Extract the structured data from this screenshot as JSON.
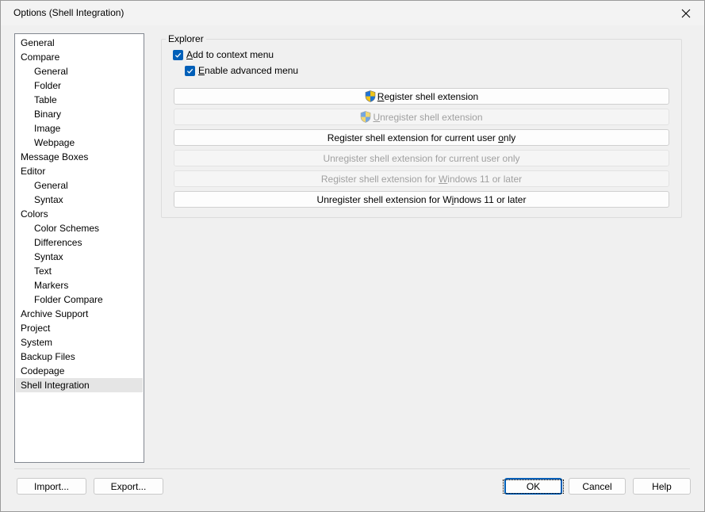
{
  "window": {
    "title": "Options (Shell Integration)"
  },
  "tree": {
    "items": [
      {
        "label": "General",
        "level": 0
      },
      {
        "label": "Compare",
        "level": 0
      },
      {
        "label": "General",
        "level": 1
      },
      {
        "label": "Folder",
        "level": 1
      },
      {
        "label": "Table",
        "level": 1
      },
      {
        "label": "Binary",
        "level": 1
      },
      {
        "label": "Image",
        "level": 1
      },
      {
        "label": "Webpage",
        "level": 1
      },
      {
        "label": "Message Boxes",
        "level": 0
      },
      {
        "label": "Editor",
        "level": 0
      },
      {
        "label": "General",
        "level": 1
      },
      {
        "label": "Syntax",
        "level": 1
      },
      {
        "label": "Colors",
        "level": 0
      },
      {
        "label": "Color Schemes",
        "level": 1
      },
      {
        "label": "Differences",
        "level": 1
      },
      {
        "label": "Syntax",
        "level": 1
      },
      {
        "label": "Text",
        "level": 1
      },
      {
        "label": "Markers",
        "level": 1
      },
      {
        "label": "Folder Compare",
        "level": 1
      },
      {
        "label": "Archive Support",
        "level": 0
      },
      {
        "label": "Project",
        "level": 0
      },
      {
        "label": "System",
        "level": 0
      },
      {
        "label": "Backup Files",
        "level": 0
      },
      {
        "label": "Codepage",
        "level": 0
      },
      {
        "label": "Shell Integration",
        "level": 0,
        "selected": true
      }
    ]
  },
  "explorer": {
    "group_label": "Explorer",
    "add_to_context_menu": {
      "label_first": "A",
      "label_rest": "dd to context menu",
      "checked": true
    },
    "enable_advanced_menu": {
      "label_first": "E",
      "label_rest": "nable advanced menu",
      "checked": true
    },
    "buttons": {
      "register": {
        "pre": "",
        "ul": "R",
        "post": "egister shell extension",
        "enabled": true
      },
      "unregister": {
        "pre": "",
        "ul": "U",
        "post": "nregister shell extension",
        "enabled": false
      },
      "register_user": {
        "pre": "Register shell extension for current user ",
        "ul": "o",
        "post": "nly",
        "enabled": true
      },
      "unregister_user": {
        "label": "Unregister shell extension for current user only",
        "enabled": false
      },
      "register_win11": {
        "pre": "Register shell extension for ",
        "ul": "W",
        "post": "indows 11 or later",
        "enabled": false
      },
      "unregister_win11": {
        "pre": "Unregister shell extension for W",
        "ul": "i",
        "post": "ndows 11 or later",
        "enabled": true
      }
    }
  },
  "footer": {
    "import_label": "Import...",
    "export_label": "Export...",
    "ok_label": "OK",
    "cancel_label": "Cancel",
    "help_label": "Help"
  },
  "colors": {
    "accent": "#005fb8",
    "selected_item_bg": "#e5e5e5",
    "disabled_text": "#a0a0a0"
  },
  "icons": {
    "close": "close-icon",
    "check": "checkmark-icon",
    "shield": "uac-shield-icon"
  }
}
